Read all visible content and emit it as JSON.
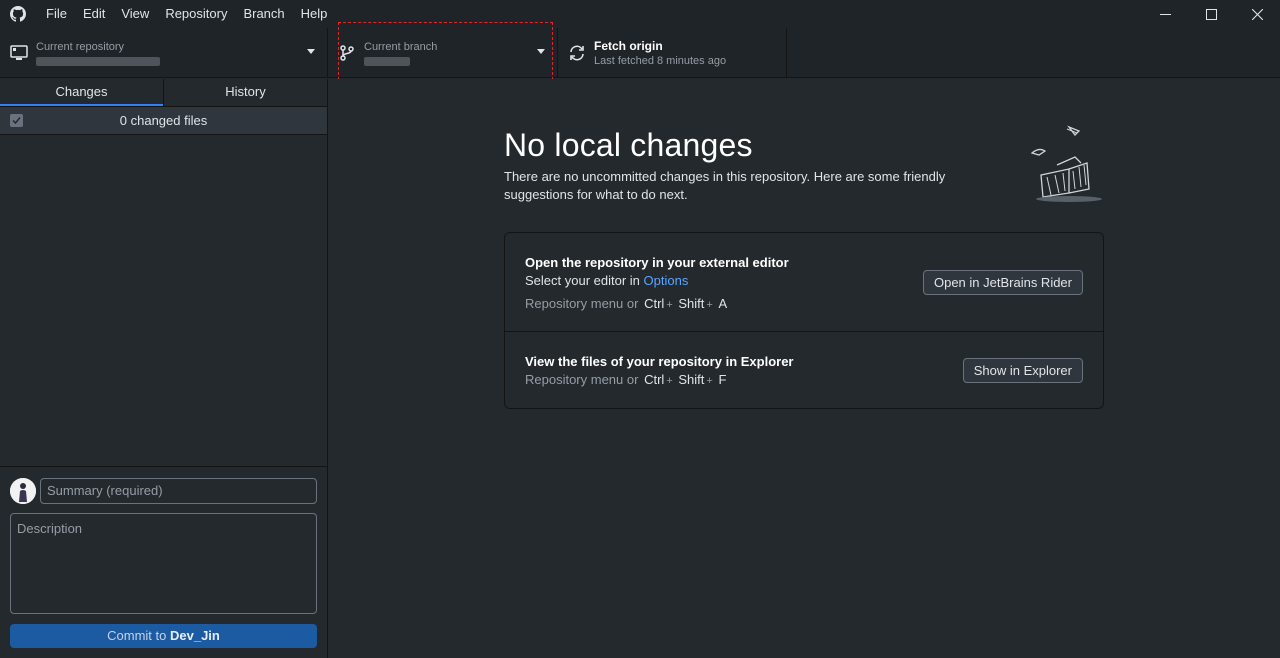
{
  "menu": {
    "items": [
      "File",
      "Edit",
      "View",
      "Repository",
      "Branch",
      "Help"
    ]
  },
  "toolbar": {
    "repository": {
      "label": "Current repository",
      "icon": "monitor-repo-icon"
    },
    "branch": {
      "label": "Current branch",
      "icon": "git-branch-icon"
    },
    "fetch": {
      "title": "Fetch origin",
      "subtitle": "Last fetched 8 minutes ago",
      "icon": "sync-icon"
    }
  },
  "sidebar": {
    "tabs": [
      {
        "label": "Changes",
        "active": true
      },
      {
        "label": "History",
        "active": false
      }
    ],
    "changes_count": "0 changed files"
  },
  "commit": {
    "summary_placeholder": "Summary (required)",
    "description_placeholder": "Description",
    "button_prefix": "Commit to ",
    "branch_name": "Dev_Jin"
  },
  "main": {
    "title": "No local changes",
    "subtitle": "There are no uncommitted changes in this repository. Here are some friendly suggestions for what to do next.",
    "actions": [
      {
        "title": "Open the repository in your external editor",
        "desc_prefix": "Select your editor in ",
        "desc_link": "Options",
        "hint_prefix": "Repository menu or",
        "keys": [
          "Ctrl",
          "Shift",
          "A"
        ],
        "button": "Open in JetBrains Rider"
      },
      {
        "title": "View the files of your repository in Explorer",
        "hint_prefix": "Repository menu or",
        "keys": [
          "Ctrl",
          "Shift",
          "F"
        ],
        "button": "Show in Explorer"
      }
    ]
  },
  "colors": {
    "accent": "#2f81f7",
    "commit_button": "#1c5aa2",
    "link": "#58a6ff",
    "highlight": "#e0262a"
  }
}
